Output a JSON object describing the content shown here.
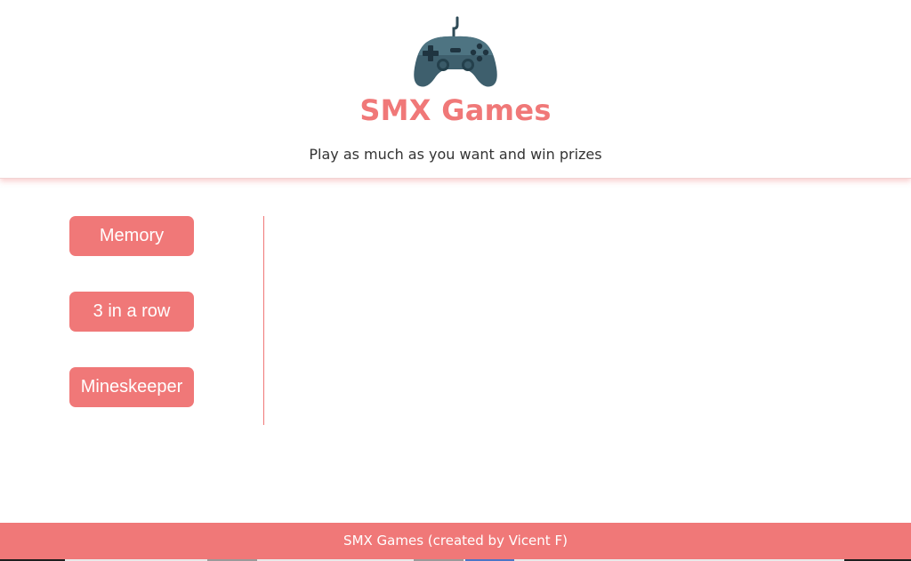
{
  "header": {
    "logo_icon": "gamepad-icon",
    "title": "SMX Games",
    "tagline": "Play as much as you want and win prizes"
  },
  "sidebar": {
    "items": [
      {
        "label": "Memory"
      },
      {
        "label": "3 in a row"
      },
      {
        "label": "Mineskeeper"
      }
    ]
  },
  "footer": {
    "text": "SMX Games (created by Vicent F)"
  },
  "colors": {
    "accent": "#f07878",
    "text": "#333333",
    "background": "#ffffff",
    "logo": "#2f4b57"
  }
}
